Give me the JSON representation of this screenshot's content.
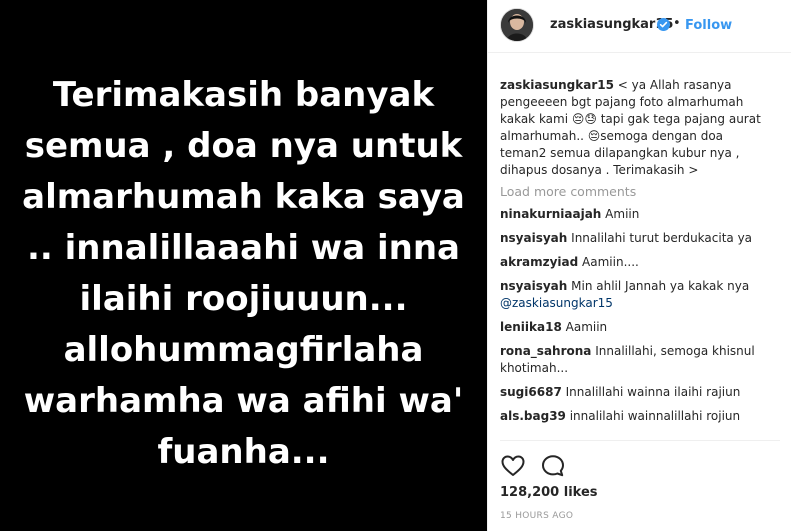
{
  "post": {
    "image_text": "Terimakasih banyak semua , doa nya untuk almarhumah kaka saya .. innalillaaahi wa inna ilaihi roojiuuun... allohummagfirlaha warhamha wa afihi wa' fuanha..."
  },
  "header": {
    "username": "zaskiasungkar15",
    "dot": "•",
    "follow_label": "Follow",
    "avatar_icon": "profile-avatar-icon",
    "verified_icon": "verified-badge-icon"
  },
  "caption": {
    "username": "zaskiasungkar15",
    "text": "< ya Allah rasanya pengeeeen bgt pajang foto almarhumah kakak kami 😔😓 tapi gak tega pajang aurat almarhumah.. 😔semoga dengan doa teman2 semua dilapangkan kubur nya , dihapus dosanya . Terimakasih >"
  },
  "load_more": "Load more comments",
  "comments": [
    {
      "username": "ninakurniaajah",
      "text": "Amiin"
    },
    {
      "username": "nsyaisyah",
      "text": "Innalilahi turut berdukacita ya"
    },
    {
      "username": "akramzyiad",
      "text": "Aamiin...."
    },
    {
      "username": "nsyaisyah",
      "text": "Min ahlil Jannah ya kakak nya",
      "mention": "@zaskiasungkar15"
    },
    {
      "username": "leniika18",
      "text": "Aamiin"
    },
    {
      "username": "rona_sahrona",
      "text": "Innalillahi, semoga khisnul khotimah..."
    },
    {
      "username": "sugi6687",
      "text": "Innalillahi wainna ilaihi rajiun"
    },
    {
      "username": "als.bag39",
      "text": "innalilahi wainnalillahi rojiun"
    }
  ],
  "actions": {
    "like_icon": "heart-icon",
    "comment_icon": "comment-icon"
  },
  "likes": "128,200 likes",
  "timestamp": "15 HOURS AGO",
  "colors": {
    "accent": "#3897f0",
    "text": "#262626",
    "muted": "#999999",
    "media_bg": "#000000"
  }
}
